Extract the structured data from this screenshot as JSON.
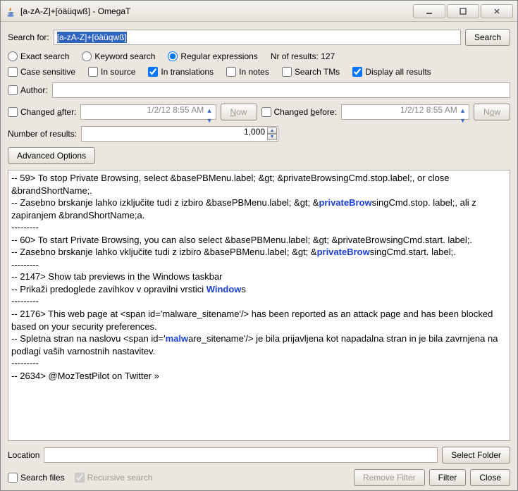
{
  "window": {
    "title": "[a-zA-Z]+[öäüqwß] - OmegaT"
  },
  "search": {
    "label": "Search for:",
    "value": "[a-zA-Z]+[öäüqwß]",
    "button": "Search"
  },
  "mode": {
    "exact": "Exact search",
    "keyword": "Keyword search",
    "regex": "Regular expressions",
    "results_label": "Nr of results: 127"
  },
  "flags": {
    "case": "Case sensitive",
    "in_source": "In source",
    "in_translations": "In translations",
    "in_notes": "In notes",
    "search_tms": "Search TMs",
    "display_all": "Display all results"
  },
  "author": {
    "label": "Author:",
    "value": ""
  },
  "dates": {
    "after_label_pre": "Changed ",
    "after_label_key": "a",
    "after_label_post": "fter:",
    "before_label_pre": "Changed ",
    "before_label_key": "b",
    "before_label_post": "efore:",
    "value": "1/2/12 8:55 AM",
    "now": "Now"
  },
  "num": {
    "label": "Number of results:",
    "value": "1,000"
  },
  "advanced": "Advanced Options",
  "location": {
    "label": "Location",
    "value": "",
    "select": "Select Folder"
  },
  "bottom": {
    "search_files": "Search files",
    "recursive": "Recursive search",
    "remove_filter": "Remove Filter",
    "filter": "Filter",
    "close": "Close"
  },
  "results_text": {
    "l1": "-- 59> To stop Private Browsing, select &basePBMenu.label; &gt; &privateBrowsingCmd.stop.label;, or close &brandShortName;.",
    "l2a": "-- Zasebno brskanje lahko izključite tudi z izbiro &basePBMenu.label; &gt; &",
    "l2b": "privateBrow",
    "l2c": "singCmd.stop. label;, ali z zapiranjem &brandShortName;a.",
    "sep": "---------",
    "l3": "-- 60> To start Private Browsing, you can also select &basePBMenu.label; &gt; &privateBrowsingCmd.start. label;.",
    "l4a": "-- Zasebno brskanje lahko vključite tudi z izbiro &basePBMenu.label; &gt; &",
    "l4b": "privateBrow",
    "l4c": "singCmd.start. label;.",
    "l5": "-- 2147> Show tab previews in the Windows taskbar",
    "l6a": "-- Prikaži predoglede zavihkov v opravilni vrstici ",
    "l6b": "Window",
    "l6c": "s",
    "l7": "-- 2176> This web page at <span id='malware_sitename'/> has been reported as an attack page and has been blocked based on your security preferences.",
    "l8a": "-- Spletna stran na naslovu <span id='",
    "l8b": "malw",
    "l8c": "are_sitename'/> je bila prijavljena kot napadalna stran in je bila zavrnjena na podlagi vaših varnostnih nastavitev.",
    "l9": "-- 2634> @MozTestPilot on Twitter »"
  }
}
